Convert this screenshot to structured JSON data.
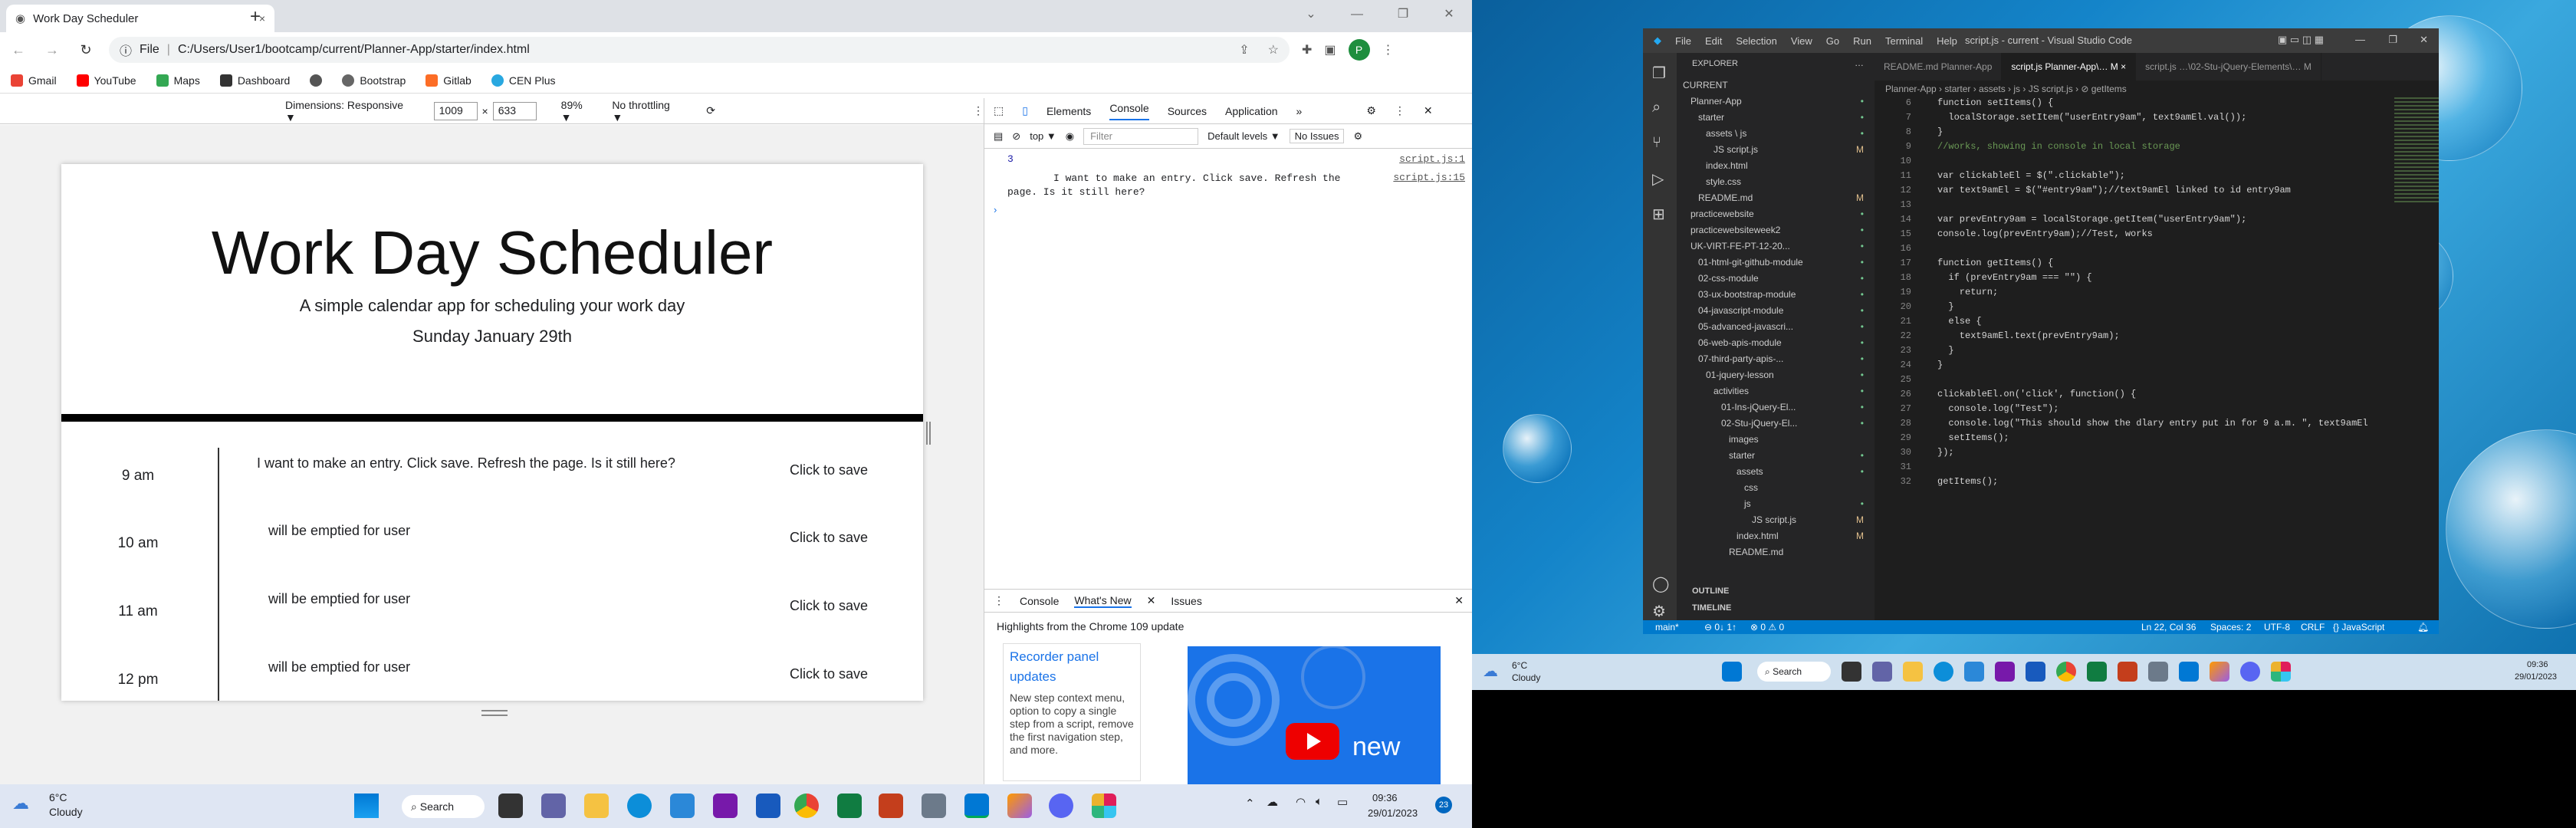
{
  "browser": {
    "tab_title": "Work Day Scheduler",
    "tab_close": "×",
    "new_tab": "+",
    "address_prefix": "File",
    "address_url": "C:/Users/User1/bootcamp/current/Planner-App/starter/index.html",
    "profile_initial": "P",
    "bookmarks": [
      "Gmail",
      "YouTube",
      "Maps",
      "Dashboard",
      "Bootstrap",
      "Gitlab",
      "CEN Plus"
    ]
  },
  "device_toolbar": {
    "dimensions_label": "Dimensions: Responsive ▼",
    "width": "1009",
    "height": "633",
    "times": "×",
    "zoom": "89% ▼",
    "throttle": "No throttling ▼"
  },
  "page": {
    "title": "Work Day Scheduler",
    "subtitle": "A simple calendar app for scheduling your work day",
    "date": "Sunday January 29th",
    "rows": [
      {
        "hour": "9 am",
        "entry": "I want to make an entry. Click save. Refresh the page. Is it still here?",
        "save": "Click to save"
      },
      {
        "hour": "10 am",
        "entry": "will be emptied for user",
        "save": "Click to save"
      },
      {
        "hour": "11 am",
        "entry": "will be emptied for user",
        "save": "Click to save"
      },
      {
        "hour": "12 pm",
        "entry": "will be emptied for user",
        "save": "Click to save"
      }
    ]
  },
  "devtools": {
    "tabs": [
      "Elements",
      "Console",
      "Sources",
      "Application",
      "»"
    ],
    "context": "top ▼",
    "filter_placeholder": "Filter",
    "levels": "Default levels ▼",
    "issues": "No Issues",
    "log1_value": "3",
    "log1_source": "script.js:1",
    "log2_text": "I want to make an entry. Click save. Refresh the page. Is it still here?",
    "log2_source": "script.js:15",
    "prompt": "›",
    "drawer_tabs": [
      "Console",
      "What's New",
      "Issues"
    ],
    "highlights": "Highlights from the Chrome 109 update",
    "card_title": "Recorder panel updates",
    "card_desc": "New step context menu, option to copy a single step from a script, remove the first navigation step, and more.",
    "video_text": "new"
  },
  "taskbar_left": {
    "weather_temp": "6°C",
    "weather_desc": "Cloudy",
    "search": "Search",
    "time": "09:36",
    "date": "29/01/2023",
    "badge": "23"
  },
  "vscode": {
    "menu": [
      "File",
      "Edit",
      "Selection",
      "View",
      "Go",
      "Run",
      "Terminal",
      "Help"
    ],
    "window_title": "script.js - current - Visual Studio Code",
    "explorer_label": "EXPLORER",
    "tabs": [
      "README.md Planner-App",
      "script.js Planner-App\\… M ×",
      "script.js …\\02-Stu-jQuery-Elements\\… M"
    ],
    "breadcrumb": "Planner-App › starter › assets › js › JS script.js › ⊘ getItems",
    "tree": [
      {
        "label": "CURRENT",
        "indent": 0
      },
      {
        "label": "Planner-App",
        "indent": 1,
        "badge": "•"
      },
      {
        "label": "starter",
        "indent": 2,
        "badge": "•"
      },
      {
        "label": "assets \\ js",
        "indent": 3,
        "badge": "•"
      },
      {
        "label": "JS script.js",
        "indent": 4,
        "badge": "M"
      },
      {
        "label": "index.html",
        "indent": 3,
        "badge": ""
      },
      {
        "label": "style.css",
        "indent": 3,
        "badge": ""
      },
      {
        "label": "README.md",
        "indent": 2,
        "badge": "M"
      },
      {
        "label": "practicewebsite",
        "indent": 1,
        "badge": "•"
      },
      {
        "label": "practicewebsiteweek2",
        "indent": 1,
        "badge": "•"
      },
      {
        "label": "UK-VIRT-FE-PT-12-20...",
        "indent": 1,
        "badge": "•"
      },
      {
        "label": "01-html-git-github-module",
        "indent": 2,
        "badge": "•"
      },
      {
        "label": "02-css-module",
        "indent": 2,
        "badge": "•"
      },
      {
        "label": "03-ux-bootstrap-module",
        "indent": 2,
        "badge": "•"
      },
      {
        "label": "04-javascript-module",
        "indent": 2,
        "badge": "•"
      },
      {
        "label": "05-advanced-javascri...",
        "indent": 2,
        "badge": "•"
      },
      {
        "label": "06-web-apis-module",
        "indent": 2,
        "badge": "•"
      },
      {
        "label": "07-third-party-apis-...",
        "indent": 2,
        "badge": "•"
      },
      {
        "label": "01-jquery-lesson",
        "indent": 3,
        "badge": "•"
      },
      {
        "label": "activities",
        "indent": 4,
        "badge": "•"
      },
      {
        "label": "01-Ins-jQuery-El...",
        "indent": 5,
        "badge": "•"
      },
      {
        "label": "02-Stu-jQuery-El...",
        "indent": 5,
        "badge": "•"
      },
      {
        "label": "images",
        "indent": 6,
        "badge": ""
      },
      {
        "label": "starter",
        "indent": 6,
        "badge": "•"
      },
      {
        "label": "assets",
        "indent": 7,
        "badge": "•"
      },
      {
        "label": "css",
        "indent": 8,
        "badge": ""
      },
      {
        "label": "js",
        "indent": 8,
        "badge": "•"
      },
      {
        "label": "JS script.js",
        "indent": 9,
        "badge": "M"
      },
      {
        "label": "index.html",
        "indent": 7,
        "badge": "M"
      },
      {
        "label": "README.md",
        "indent": 6,
        "badge": ""
      }
    ],
    "outline": "OUTLINE",
    "timeline": "TIMELINE",
    "code": [
      {
        "n": "6",
        "t": "function setItems() {"
      },
      {
        "n": "7",
        "t": "  localStorage.setItem(\"userEntry9am\", text9amEl.val());"
      },
      {
        "n": "8",
        "t": "}"
      },
      {
        "n": "9",
        "t": "//works, showing in console in local storage"
      },
      {
        "n": "10",
        "t": ""
      },
      {
        "n": "11",
        "t": "var clickableEl = $(\".clickable\");"
      },
      {
        "n": "12",
        "t": "var text9amEl = $(\"#entry9am\");//text9amEl linked to id entry9am"
      },
      {
        "n": "13",
        "t": ""
      },
      {
        "n": "14",
        "t": "var prevEntry9am = localStorage.getItem(\"userEntry9am\");"
      },
      {
        "n": "15",
        "t": "console.log(prevEntry9am);//Test, works"
      },
      {
        "n": "16",
        "t": ""
      },
      {
        "n": "17",
        "t": "function getItems() {"
      },
      {
        "n": "18",
        "t": "  if (prevEntry9am === \"\") {"
      },
      {
        "n": "19",
        "t": "    return;"
      },
      {
        "n": "20",
        "t": "  }"
      },
      {
        "n": "21",
        "t": "  else {"
      },
      {
        "n": "22",
        "t": "    text9amEl.text(prevEntry9am);"
      },
      {
        "n": "23",
        "t": "  }"
      },
      {
        "n": "24",
        "t": "}"
      },
      {
        "n": "25",
        "t": ""
      },
      {
        "n": "26",
        "t": "clickableEl.on('click', function() {"
      },
      {
        "n": "27",
        "t": "  console.log(\"Test\");"
      },
      {
        "n": "28",
        "t": "  console.log(\"This should show the dlary entry put in for 9 a.m. \", text9amEl"
      },
      {
        "n": "29",
        "t": "  setItems();"
      },
      {
        "n": "30",
        "t": "});"
      },
      {
        "n": "31",
        "t": ""
      },
      {
        "n": "32",
        "t": "getItems();"
      }
    ],
    "status": {
      "branch": "main*",
      "sync": "⊖ 0↓ 1↑",
      "problems": "⊗ 0 ⚠ 0",
      "position": "Ln 22, Col 36",
      "spaces": "Spaces: 2",
      "encoding": "UTF-8",
      "eol": "CRLF",
      "language": "{} JavaScript"
    }
  },
  "taskbar_right": {
    "weather_temp": "6°C",
    "weather_desc": "Cloudy",
    "search": "Search",
    "time": "09:36",
    "date": "29/01/2023"
  }
}
